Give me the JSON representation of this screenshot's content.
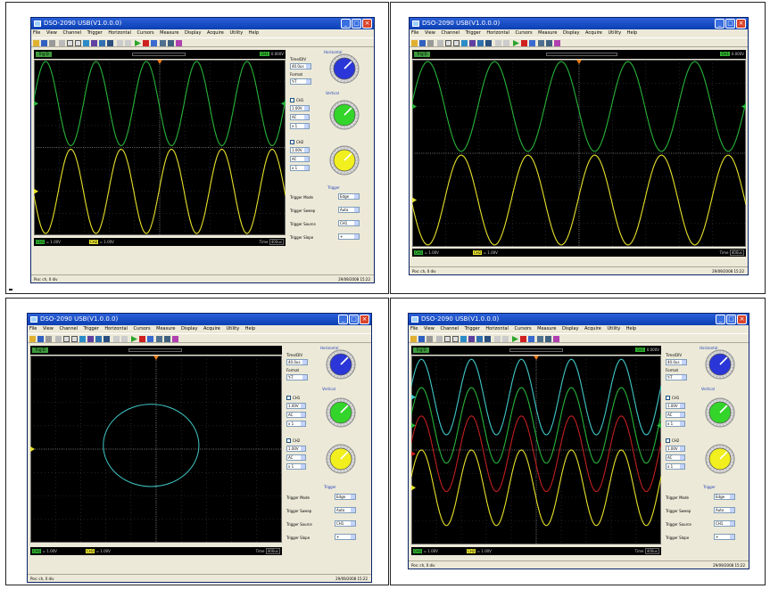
{
  "app": {
    "title": "DSO-2090 USB(V1.0.0.0)",
    "menu": [
      "File",
      "View",
      "Channel",
      "Trigger",
      "Horizontal",
      "Cursors",
      "Measure",
      "Display",
      "Acquire",
      "Utility",
      "Help"
    ],
    "status_text": "Pos: ch, 0 div",
    "status_datetime": "29/09/2008 15:22"
  },
  "toolbar_icons": [
    "open-icon",
    "save-icon",
    "print-icon",
    "zoom-icon",
    "cursor-icon",
    "select-icon",
    "measure-icon",
    "channel-icon",
    "trigger-icon",
    "display-icon",
    "arrow-left-icon",
    "arrow-right-icon",
    "run-icon",
    "stop-icon",
    "single-icon",
    "grid-icon",
    "grid2-icon",
    "help-icon"
  ],
  "panels": [
    {
      "trig_state": "Trig'D",
      "ch_tag": "CH1",
      "ch_value": "0.000V",
      "ch1_label": "CH1",
      "ch1_value": "= 1.00V",
      "ch2_label": "CH2",
      "ch2_value": "= 1.00V",
      "time_label": "Time",
      "time_value": "400us",
      "status_text": "Pos: ch, 0 div",
      "datetime": "29/09/2008 15:22",
      "mode": "Y-T",
      "horizontal_title": "Horizontal",
      "time_div_label": "Time/DIV",
      "time_div_value": "40.0us",
      "format_label": "Format",
      "format_value": "Y-T",
      "vertical_title": "Vertical",
      "ch1_chk": "CH1",
      "ch1_volt": "1.00V",
      "ch1_coupling": "AC",
      "ch1_probe": "x 1",
      "ch2_chk": "CH2",
      "ch2_volt": "1.00V",
      "ch2_coupling": "AC",
      "ch2_probe": "x 1",
      "trigger_title": "Trigger",
      "trigger_mode_label": "Trigger Mode",
      "trigger_mode": "Edge",
      "trigger_sweep_label": "Trigger Sweep",
      "trigger_sweep": "Auto",
      "trigger_source_label": "Trigger Source",
      "trigger_source": "CH1",
      "trigger_slope_label": "Trigger Slope",
      "trigger_slope": "+"
    }
  ],
  "colors": {
    "ch1": "#27b43a",
    "ch2": "#e7e22b",
    "ch3": "#40c8c8",
    "red": "#c21f1f",
    "knob_h": "#2a36d8",
    "knob_v1": "#33d52b",
    "knob_v2": "#f1ef1e"
  }
}
